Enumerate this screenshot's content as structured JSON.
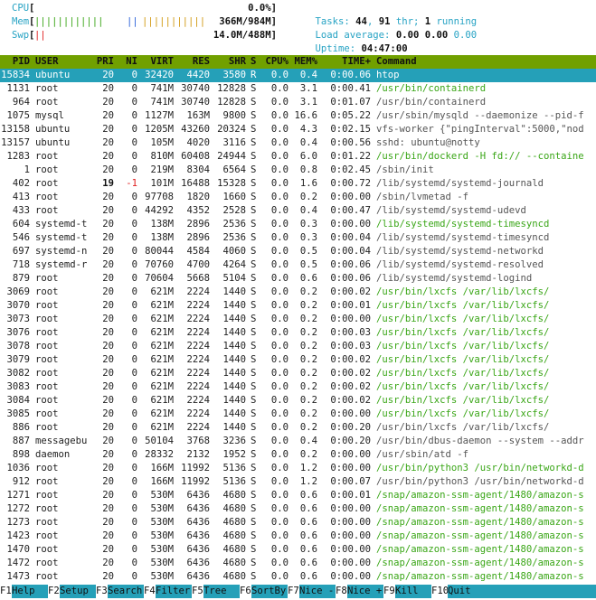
{
  "meters": {
    "cpu": {
      "label": "CPU",
      "open": "[",
      "bar": "",
      "value": "0.0%]"
    },
    "mem": {
      "label": "Mem",
      "open": "[",
      "bar_green": "||||||||||||",
      "bar_blue": "||",
      "bar_yellow": "|||||||||||",
      "value": "366M/984M]"
    },
    "swp": {
      "label": "Swp",
      "open": "[",
      "bar_red": "||",
      "value": "14.0M/488M]"
    }
  },
  "info": {
    "tasks_label": "Tasks: ",
    "tasks": "44",
    "sep1": ", ",
    "thr": "91",
    "thr_label": " thr; ",
    "running": "1",
    "running_label": " running",
    "load_label": "Load average: ",
    "load1": "0.00",
    "load5": "0.00",
    "load15": "0.00",
    "uptime_label": "Uptime: ",
    "uptime": "04:47:00"
  },
  "columns": [
    "PID",
    "USER",
    "PRI",
    "NI",
    "VIRT",
    "RES",
    "SHR",
    "S",
    "CPU%",
    "MEM%",
    "TIME+",
    "Command"
  ],
  "processes": [
    {
      "pid": "15834",
      "user": "ubuntu",
      "pri": "20",
      "ni": "0",
      "virt": "32420",
      "res": "4420",
      "shr": "3580",
      "s": "R",
      "cpu": "0.0",
      "mem": "0.4",
      "time": "0:00.06",
      "cmd": "htop",
      "sel": true
    },
    {
      "pid": "1131",
      "user": "root",
      "pri": "20",
      "ni": "0",
      "virt": "741M",
      "res": "30740",
      "shr": "12828",
      "s": "S",
      "cpu": "0.0",
      "mem": "3.1",
      "time": "0:00.41",
      "cmd": "/usr/bin/containerd",
      "green": true
    },
    {
      "pid": "964",
      "user": "root",
      "pri": "20",
      "ni": "0",
      "virt": "741M",
      "res": "30740",
      "shr": "12828",
      "s": "S",
      "cpu": "0.0",
      "mem": "3.1",
      "time": "0:01.07",
      "cmd": "/usr/bin/containerd"
    },
    {
      "pid": "1075",
      "user": "mysql",
      "pri": "20",
      "ni": "0",
      "virt": "1127M",
      "res": "163M",
      "shr": "9800",
      "s": "S",
      "cpu": "0.0",
      "mem": "16.6",
      "time": "0:05.22",
      "cmd": "/usr/sbin/mysqld --daemonize --pid-f"
    },
    {
      "pid": "13158",
      "user": "ubuntu",
      "pri": "20",
      "ni": "0",
      "virt": "1205M",
      "res": "43260",
      "shr": "20324",
      "s": "S",
      "cpu": "0.0",
      "mem": "4.3",
      "time": "0:02.15",
      "cmd": "vfs-worker {\"pingInterval\":5000,\"nod"
    },
    {
      "pid": "13157",
      "user": "ubuntu",
      "pri": "20",
      "ni": "0",
      "virt": "105M",
      "res": "4020",
      "shr": "3116",
      "s": "S",
      "cpu": "0.0",
      "mem": "0.4",
      "time": "0:00.56",
      "cmd": "sshd: ubuntu@notty"
    },
    {
      "pid": "1283",
      "user": "root",
      "pri": "20",
      "ni": "0",
      "virt": "810M",
      "res": "60408",
      "shr": "24944",
      "s": "S",
      "cpu": "0.0",
      "mem": "6.0",
      "time": "0:01.22",
      "cmd": "/usr/bin/dockerd -H fd:// --containe",
      "green": true
    },
    {
      "pid": "1",
      "user": "root",
      "pri": "20",
      "ni": "0",
      "virt": "219M",
      "res": "8304",
      "shr": "6564",
      "s": "S",
      "cpu": "0.0",
      "mem": "0.8",
      "time": "0:02.45",
      "cmd": "/sbin/init"
    },
    {
      "pid": "402",
      "user": "root",
      "pri": "19",
      "ni": "-1",
      "virt": "101M",
      "res": "16488",
      "shr": "15328",
      "s": "S",
      "cpu": "0.0",
      "mem": "1.6",
      "time": "0:00.72",
      "cmd": "/lib/systemd/systemd-journald",
      "nired": true
    },
    {
      "pid": "413",
      "user": "root",
      "pri": "20",
      "ni": "0",
      "virt": "97708",
      "res": "1820",
      "shr": "1660",
      "s": "S",
      "cpu": "0.0",
      "mem": "0.2",
      "time": "0:00.00",
      "cmd": "/sbin/lvmetad -f"
    },
    {
      "pid": "433",
      "user": "root",
      "pri": "20",
      "ni": "0",
      "virt": "44292",
      "res": "4352",
      "shr": "2528",
      "s": "S",
      "cpu": "0.0",
      "mem": "0.4",
      "time": "0:00.47",
      "cmd": "/lib/systemd/systemd-udevd"
    },
    {
      "pid": "604",
      "user": "systemd-t",
      "pri": "20",
      "ni": "0",
      "virt": "138M",
      "res": "2896",
      "shr": "2536",
      "s": "S",
      "cpu": "0.0",
      "mem": "0.3",
      "time": "0:00.00",
      "cmd": "/lib/systemd/systemd-timesyncd",
      "green": true
    },
    {
      "pid": "546",
      "user": "systemd-t",
      "pri": "20",
      "ni": "0",
      "virt": "138M",
      "res": "2896",
      "shr": "2536",
      "s": "S",
      "cpu": "0.0",
      "mem": "0.3",
      "time": "0:00.04",
      "cmd": "/lib/systemd/systemd-timesyncd"
    },
    {
      "pid": "697",
      "user": "systemd-n",
      "pri": "20",
      "ni": "0",
      "virt": "80044",
      "res": "4584",
      "shr": "4060",
      "s": "S",
      "cpu": "0.0",
      "mem": "0.5",
      "time": "0:00.04",
      "cmd": "/lib/systemd/systemd-networkd"
    },
    {
      "pid": "718",
      "user": "systemd-r",
      "pri": "20",
      "ni": "0",
      "virt": "70760",
      "res": "4700",
      "shr": "4264",
      "s": "S",
      "cpu": "0.0",
      "mem": "0.5",
      "time": "0:00.06",
      "cmd": "/lib/systemd/systemd-resolved"
    },
    {
      "pid": "879",
      "user": "root",
      "pri": "20",
      "ni": "0",
      "virt": "70604",
      "res": "5668",
      "shr": "5104",
      "s": "S",
      "cpu": "0.0",
      "mem": "0.6",
      "time": "0:00.06",
      "cmd": "/lib/systemd/systemd-logind"
    },
    {
      "pid": "3069",
      "user": "root",
      "pri": "20",
      "ni": "0",
      "virt": "621M",
      "res": "2224",
      "shr": "1440",
      "s": "S",
      "cpu": "0.0",
      "mem": "0.2",
      "time": "0:00.02",
      "cmd": "/usr/bin/lxcfs /var/lib/lxcfs/",
      "green": true
    },
    {
      "pid": "3070",
      "user": "root",
      "pri": "20",
      "ni": "0",
      "virt": "621M",
      "res": "2224",
      "shr": "1440",
      "s": "S",
      "cpu": "0.0",
      "mem": "0.2",
      "time": "0:00.01",
      "cmd": "/usr/bin/lxcfs /var/lib/lxcfs/",
      "green": true
    },
    {
      "pid": "3073",
      "user": "root",
      "pri": "20",
      "ni": "0",
      "virt": "621M",
      "res": "2224",
      "shr": "1440",
      "s": "S",
      "cpu": "0.0",
      "mem": "0.2",
      "time": "0:00.00",
      "cmd": "/usr/bin/lxcfs /var/lib/lxcfs/",
      "green": true
    },
    {
      "pid": "3076",
      "user": "root",
      "pri": "20",
      "ni": "0",
      "virt": "621M",
      "res": "2224",
      "shr": "1440",
      "s": "S",
      "cpu": "0.0",
      "mem": "0.2",
      "time": "0:00.03",
      "cmd": "/usr/bin/lxcfs /var/lib/lxcfs/",
      "green": true
    },
    {
      "pid": "3078",
      "user": "root",
      "pri": "20",
      "ni": "0",
      "virt": "621M",
      "res": "2224",
      "shr": "1440",
      "s": "S",
      "cpu": "0.0",
      "mem": "0.2",
      "time": "0:00.03",
      "cmd": "/usr/bin/lxcfs /var/lib/lxcfs/",
      "green": true
    },
    {
      "pid": "3079",
      "user": "root",
      "pri": "20",
      "ni": "0",
      "virt": "621M",
      "res": "2224",
      "shr": "1440",
      "s": "S",
      "cpu": "0.0",
      "mem": "0.2",
      "time": "0:00.02",
      "cmd": "/usr/bin/lxcfs /var/lib/lxcfs/",
      "green": true
    },
    {
      "pid": "3082",
      "user": "root",
      "pri": "20",
      "ni": "0",
      "virt": "621M",
      "res": "2224",
      "shr": "1440",
      "s": "S",
      "cpu": "0.0",
      "mem": "0.2",
      "time": "0:00.02",
      "cmd": "/usr/bin/lxcfs /var/lib/lxcfs/",
      "green": true
    },
    {
      "pid": "3083",
      "user": "root",
      "pri": "20",
      "ni": "0",
      "virt": "621M",
      "res": "2224",
      "shr": "1440",
      "s": "S",
      "cpu": "0.0",
      "mem": "0.2",
      "time": "0:00.02",
      "cmd": "/usr/bin/lxcfs /var/lib/lxcfs/",
      "green": true
    },
    {
      "pid": "3084",
      "user": "root",
      "pri": "20",
      "ni": "0",
      "virt": "621M",
      "res": "2224",
      "shr": "1440",
      "s": "S",
      "cpu": "0.0",
      "mem": "0.2",
      "time": "0:00.02",
      "cmd": "/usr/bin/lxcfs /var/lib/lxcfs/",
      "green": true
    },
    {
      "pid": "3085",
      "user": "root",
      "pri": "20",
      "ni": "0",
      "virt": "621M",
      "res": "2224",
      "shr": "1440",
      "s": "S",
      "cpu": "0.0",
      "mem": "0.2",
      "time": "0:00.00",
      "cmd": "/usr/bin/lxcfs /var/lib/lxcfs/",
      "green": true
    },
    {
      "pid": "886",
      "user": "root",
      "pri": "20",
      "ni": "0",
      "virt": "621M",
      "res": "2224",
      "shr": "1440",
      "s": "S",
      "cpu": "0.0",
      "mem": "0.2",
      "time": "0:00.20",
      "cmd": "/usr/bin/lxcfs /var/lib/lxcfs/"
    },
    {
      "pid": "887",
      "user": "messagebu",
      "pri": "20",
      "ni": "0",
      "virt": "50104",
      "res": "3768",
      "shr": "3236",
      "s": "S",
      "cpu": "0.0",
      "mem": "0.4",
      "time": "0:00.20",
      "cmd": "/usr/bin/dbus-daemon --system --addr"
    },
    {
      "pid": "898",
      "user": "daemon",
      "pri": "20",
      "ni": "0",
      "virt": "28332",
      "res": "2132",
      "shr": "1952",
      "s": "S",
      "cpu": "0.0",
      "mem": "0.2",
      "time": "0:00.00",
      "cmd": "/usr/sbin/atd -f"
    },
    {
      "pid": "1036",
      "user": "root",
      "pri": "20",
      "ni": "0",
      "virt": "166M",
      "res": "11992",
      "shr": "5136",
      "s": "S",
      "cpu": "0.0",
      "mem": "1.2",
      "time": "0:00.00",
      "cmd": "/usr/bin/python3 /usr/bin/networkd-d",
      "green": true
    },
    {
      "pid": "912",
      "user": "root",
      "pri": "20",
      "ni": "0",
      "virt": "166M",
      "res": "11992",
      "shr": "5136",
      "s": "S",
      "cpu": "0.0",
      "mem": "1.2",
      "time": "0:00.07",
      "cmd": "/usr/bin/python3 /usr/bin/networkd-d"
    },
    {
      "pid": "1271",
      "user": "root",
      "pri": "20",
      "ni": "0",
      "virt": "530M",
      "res": "6436",
      "shr": "4680",
      "s": "S",
      "cpu": "0.0",
      "mem": "0.6",
      "time": "0:00.01",
      "cmd": "/snap/amazon-ssm-agent/1480/amazon-s",
      "green": true
    },
    {
      "pid": "1272",
      "user": "root",
      "pri": "20",
      "ni": "0",
      "virt": "530M",
      "res": "6436",
      "shr": "4680",
      "s": "S",
      "cpu": "0.0",
      "mem": "0.6",
      "time": "0:00.00",
      "cmd": "/snap/amazon-ssm-agent/1480/amazon-s",
      "green": true
    },
    {
      "pid": "1273",
      "user": "root",
      "pri": "20",
      "ni": "0",
      "virt": "530M",
      "res": "6436",
      "shr": "4680",
      "s": "S",
      "cpu": "0.0",
      "mem": "0.6",
      "time": "0:00.00",
      "cmd": "/snap/amazon-ssm-agent/1480/amazon-s",
      "green": true
    },
    {
      "pid": "1423",
      "user": "root",
      "pri": "20",
      "ni": "0",
      "virt": "530M",
      "res": "6436",
      "shr": "4680",
      "s": "S",
      "cpu": "0.0",
      "mem": "0.6",
      "time": "0:00.00",
      "cmd": "/snap/amazon-ssm-agent/1480/amazon-s",
      "green": true
    },
    {
      "pid": "1470",
      "user": "root",
      "pri": "20",
      "ni": "0",
      "virt": "530M",
      "res": "6436",
      "shr": "4680",
      "s": "S",
      "cpu": "0.0",
      "mem": "0.6",
      "time": "0:00.00",
      "cmd": "/snap/amazon-ssm-agent/1480/amazon-s",
      "green": true
    },
    {
      "pid": "1472",
      "user": "root",
      "pri": "20",
      "ni": "0",
      "virt": "530M",
      "res": "6436",
      "shr": "4680",
      "s": "S",
      "cpu": "0.0",
      "mem": "0.6",
      "time": "0:00.00",
      "cmd": "/snap/amazon-ssm-agent/1480/amazon-s",
      "green": true
    },
    {
      "pid": "1473",
      "user": "root",
      "pri": "20",
      "ni": "0",
      "virt": "530M",
      "res": "6436",
      "shr": "4680",
      "s": "S",
      "cpu": "0.0",
      "mem": "0.6",
      "time": "0:00.00",
      "cmd": "/snap/amazon-ssm-agent/1480/amazon-s",
      "green": true
    }
  ],
  "footer": [
    {
      "key": "F1",
      "label": "Help"
    },
    {
      "key": "F2",
      "label": "Setup"
    },
    {
      "key": "F3",
      "label": "Search"
    },
    {
      "key": "F4",
      "label": "Filter"
    },
    {
      "key": "F5",
      "label": "Tree"
    },
    {
      "key": "F6",
      "label": "SortBy"
    },
    {
      "key": "F7",
      "label": "Nice -"
    },
    {
      "key": "F8",
      "label": "Nice +"
    },
    {
      "key": "F9",
      "label": "Kill"
    },
    {
      "key": "F10",
      "label": "Quit"
    }
  ],
  "colors": {
    "header_bg": "#71a000",
    "selection_bg": "#25a0b8",
    "cyan": "#27a3c4",
    "green": "#3aa617",
    "red": "#e02020",
    "blue": "#2a60d9",
    "yellow": "#d29a12"
  }
}
